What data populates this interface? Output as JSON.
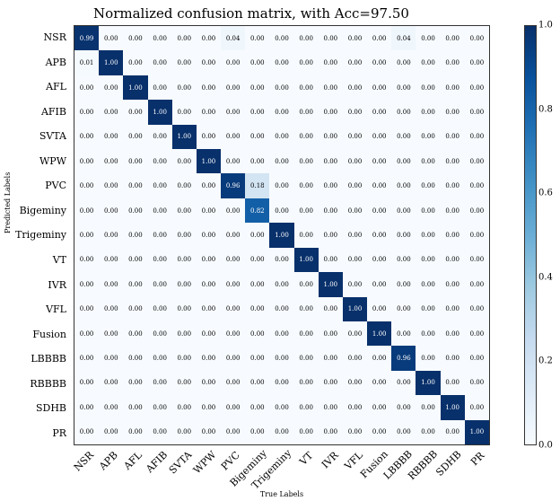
{
  "chart_data": {
    "type": "heatmap",
    "title": "Normalized confusion matrix, with Acc=97.50",
    "xlabel": "True Labels",
    "ylabel": "Predicted Labels",
    "categories": [
      "NSR",
      "APB",
      "AFL",
      "AFIB",
      "SVTA",
      "WPW",
      "PVC",
      "Bigeminy",
      "Trigeminy",
      "VT",
      "IVR",
      "VFL",
      "Fusion",
      "LBBBB",
      "RBBBB",
      "SDHB",
      "PR"
    ],
    "matrix": [
      [
        0.99,
        0.0,
        0.0,
        0.0,
        0.0,
        0.0,
        0.04,
        0.0,
        0.0,
        0.0,
        0.0,
        0.0,
        0.0,
        0.04,
        0.0,
        0.0,
        0.0
      ],
      [
        0.01,
        1.0,
        0.0,
        0.0,
        0.0,
        0.0,
        0.0,
        0.0,
        0.0,
        0.0,
        0.0,
        0.0,
        0.0,
        0.0,
        0.0,
        0.0,
        0.0
      ],
      [
        0.0,
        0.0,
        1.0,
        0.0,
        0.0,
        0.0,
        0.0,
        0.0,
        0.0,
        0.0,
        0.0,
        0.0,
        0.0,
        0.0,
        0.0,
        0.0,
        0.0
      ],
      [
        0.0,
        0.0,
        0.0,
        1.0,
        0.0,
        0.0,
        0.0,
        0.0,
        0.0,
        0.0,
        0.0,
        0.0,
        0.0,
        0.0,
        0.0,
        0.0,
        0.0
      ],
      [
        0.0,
        0.0,
        0.0,
        0.0,
        1.0,
        0.0,
        0.0,
        0.0,
        0.0,
        0.0,
        0.0,
        0.0,
        0.0,
        0.0,
        0.0,
        0.0,
        0.0
      ],
      [
        0.0,
        0.0,
        0.0,
        0.0,
        0.0,
        1.0,
        0.0,
        0.0,
        0.0,
        0.0,
        0.0,
        0.0,
        0.0,
        0.0,
        0.0,
        0.0,
        0.0
      ],
      [
        0.0,
        0.0,
        0.0,
        0.0,
        0.0,
        0.0,
        0.96,
        0.18,
        0.0,
        0.0,
        0.0,
        0.0,
        0.0,
        0.0,
        0.0,
        0.0,
        0.0
      ],
      [
        0.0,
        0.0,
        0.0,
        0.0,
        0.0,
        0.0,
        0.0,
        0.82,
        0.0,
        0.0,
        0.0,
        0.0,
        0.0,
        0.0,
        0.0,
        0.0,
        0.0
      ],
      [
        0.0,
        0.0,
        0.0,
        0.0,
        0.0,
        0.0,
        0.0,
        0.0,
        1.0,
        0.0,
        0.0,
        0.0,
        0.0,
        0.0,
        0.0,
        0.0,
        0.0
      ],
      [
        0.0,
        0.0,
        0.0,
        0.0,
        0.0,
        0.0,
        0.0,
        0.0,
        0.0,
        1.0,
        0.0,
        0.0,
        0.0,
        0.0,
        0.0,
        0.0,
        0.0
      ],
      [
        0.0,
        0.0,
        0.0,
        0.0,
        0.0,
        0.0,
        0.0,
        0.0,
        0.0,
        0.0,
        1.0,
        0.0,
        0.0,
        0.0,
        0.0,
        0.0,
        0.0
      ],
      [
        0.0,
        0.0,
        0.0,
        0.0,
        0.0,
        0.0,
        0.0,
        0.0,
        0.0,
        0.0,
        0.0,
        1.0,
        0.0,
        0.0,
        0.0,
        0.0,
        0.0
      ],
      [
        0.0,
        0.0,
        0.0,
        0.0,
        0.0,
        0.0,
        0.0,
        0.0,
        0.0,
        0.0,
        0.0,
        0.0,
        1.0,
        0.0,
        0.0,
        0.0,
        0.0
      ],
      [
        0.0,
        0.0,
        0.0,
        0.0,
        0.0,
        0.0,
        0.0,
        0.0,
        0.0,
        0.0,
        0.0,
        0.0,
        0.0,
        0.96,
        0.0,
        0.0,
        0.0
      ],
      [
        0.0,
        0.0,
        0.0,
        0.0,
        0.0,
        0.0,
        0.0,
        0.0,
        0.0,
        0.0,
        0.0,
        0.0,
        0.0,
        0.0,
        1.0,
        0.0,
        0.0
      ],
      [
        0.0,
        0.0,
        0.0,
        0.0,
        0.0,
        0.0,
        0.0,
        0.0,
        0.0,
        0.0,
        0.0,
        0.0,
        0.0,
        0.0,
        0.0,
        1.0,
        0.0
      ],
      [
        0.0,
        0.0,
        0.0,
        0.0,
        0.0,
        0.0,
        0.0,
        0.0,
        0.0,
        0.0,
        0.0,
        0.0,
        0.0,
        0.0,
        0.0,
        0.0,
        1.0
      ]
    ],
    "colorbar": {
      "min": 0.0,
      "max": 1.0,
      "ticks": [
        0.0,
        0.2,
        0.4,
        0.6,
        0.8,
        1.0
      ]
    }
  }
}
